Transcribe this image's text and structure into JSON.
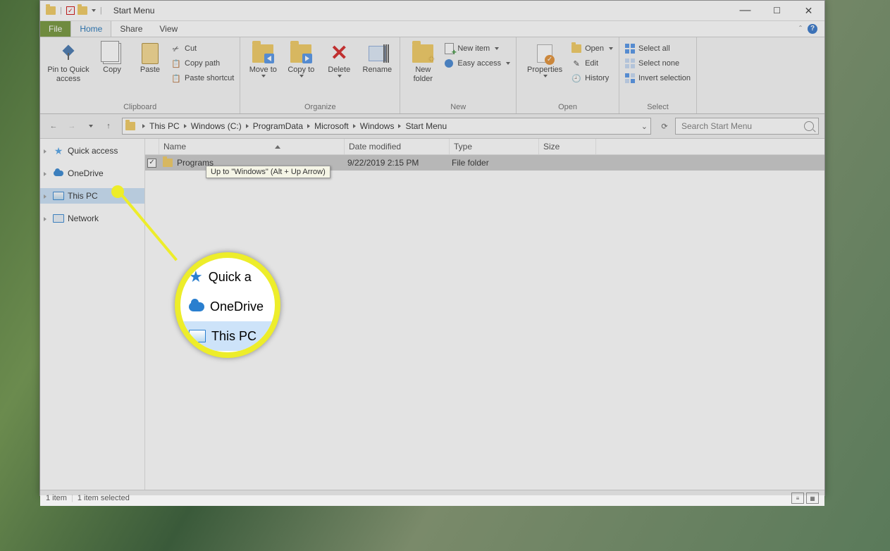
{
  "window": {
    "title": "Start Menu"
  },
  "menubar": {
    "tabs": [
      "File",
      "Home",
      "Share",
      "View"
    ]
  },
  "ribbon": {
    "clipboard": {
      "label": "Clipboard",
      "pin": "Pin to Quick access",
      "copy": "Copy",
      "paste": "Paste",
      "cut": "Cut",
      "copy_path": "Copy path",
      "paste_shortcut": "Paste shortcut"
    },
    "organize": {
      "label": "Organize",
      "move": "Move to",
      "copy": "Copy to",
      "delete": "Delete",
      "rename": "Rename"
    },
    "new": {
      "label": "New",
      "folder": "New folder",
      "new_item": "New item",
      "easy_access": "Easy access"
    },
    "open": {
      "label": "Open",
      "props": "Properties",
      "open": "Open",
      "edit": "Edit",
      "history": "History"
    },
    "select": {
      "label": "Select",
      "all": "Select all",
      "none": "Select none",
      "invert": "Invert selection"
    }
  },
  "nav": {
    "breadcrumb": [
      "This PC",
      "Windows (C:)",
      "ProgramData",
      "Microsoft",
      "Windows",
      "Start Menu"
    ],
    "search_placeholder": "Search Start Menu",
    "tooltip": "Up to \"Windows\" (Alt + Up Arrow)"
  },
  "tree": {
    "items": [
      {
        "label": "Quick access",
        "icon": "star"
      },
      {
        "label": "OneDrive",
        "icon": "cloud"
      },
      {
        "label": "This PC",
        "icon": "monitor",
        "selected": true
      },
      {
        "label": "Network",
        "icon": "netmon"
      }
    ]
  },
  "columns": {
    "name": "Name",
    "date": "Date modified",
    "type": "Type",
    "size": "Size"
  },
  "files": [
    {
      "name": "Programs",
      "date": "9/22/2019 2:15 PM",
      "type": "File folder",
      "checked": true
    }
  ],
  "status": {
    "count": "1 item",
    "selected": "1 item selected"
  },
  "callout": {
    "lines": [
      "Quick a",
      "OneDrive",
      "This PC"
    ]
  }
}
